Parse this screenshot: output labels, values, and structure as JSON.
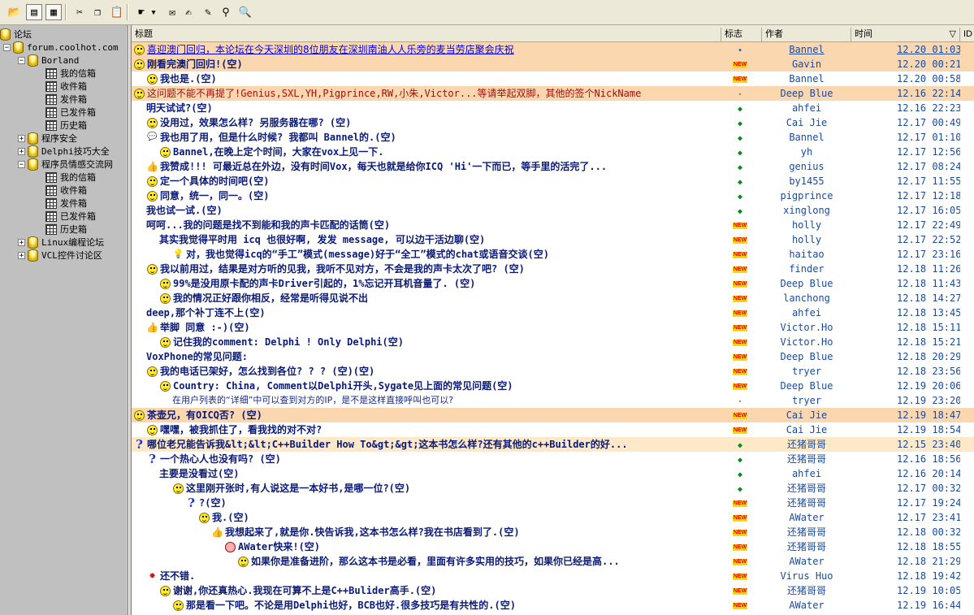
{
  "toolbar": {
    "buttons": [
      {
        "name": "open-folder-icon",
        "glyph": "📂",
        "pressed": false
      },
      {
        "name": "tree-view-icon",
        "glyph": "▤",
        "pressed": true
      },
      {
        "name": "list-view-icon",
        "glyph": "▦",
        "pressed": true
      },
      {
        "name": "cut-icon",
        "glyph": "✂",
        "pressed": false
      },
      {
        "name": "copy-icon",
        "glyph": "❐",
        "pressed": false
      },
      {
        "name": "paste-icon",
        "glyph": "📋",
        "pressed": false
      },
      {
        "name": "hand-pointer-icon",
        "glyph": "☛",
        "pressed": false
      },
      {
        "name": "dropdown-arrow-icon",
        "glyph": "▾",
        "pressed": false
      },
      {
        "name": "send-receive-icon",
        "glyph": "✉",
        "pressed": false
      },
      {
        "name": "compose-icon",
        "glyph": "✍",
        "pressed": false
      },
      {
        "name": "edit-icon",
        "glyph": "✎",
        "pressed": false
      },
      {
        "name": "binoculars-icon",
        "glyph": "⚲",
        "pressed": false
      },
      {
        "name": "magnifier-icon",
        "glyph": "🔍",
        "pressed": false
      }
    ]
  },
  "tree": {
    "nodes": [
      {
        "label": "论坛",
        "icon": "cyl",
        "level": 0,
        "box": ""
      },
      {
        "label": "forum.coolhot.com",
        "icon": "cyl",
        "level": 1,
        "box": "-"
      },
      {
        "label": "Borland",
        "icon": "cyl",
        "level": 2,
        "box": "-"
      },
      {
        "label": "我的信箱",
        "icon": "grid",
        "level": 3,
        "box": ""
      },
      {
        "label": "收件箱",
        "icon": "grid",
        "level": 3,
        "box": ""
      },
      {
        "label": "发件箱",
        "icon": "grid",
        "level": 3,
        "box": ""
      },
      {
        "label": "已发件箱",
        "icon": "grid",
        "level": 3,
        "box": ""
      },
      {
        "label": "历史箱",
        "icon": "grid",
        "level": 3,
        "box": ""
      },
      {
        "label": "程序安全",
        "icon": "cyl",
        "level": 2,
        "box": "+"
      },
      {
        "label": "Delphi技巧大全",
        "icon": "cyl",
        "level": 2,
        "box": "+"
      },
      {
        "label": "程序员情感交流网",
        "icon": "cyl",
        "level": 2,
        "box": "-"
      },
      {
        "label": "我的信箱",
        "icon": "grid",
        "level": 3,
        "box": ""
      },
      {
        "label": "收件箱",
        "icon": "grid",
        "level": 3,
        "box": ""
      },
      {
        "label": "发件箱",
        "icon": "grid",
        "level": 3,
        "box": ""
      },
      {
        "label": "已发件箱",
        "icon": "grid",
        "level": 3,
        "box": ""
      },
      {
        "label": "历史箱",
        "icon": "grid",
        "level": 3,
        "box": ""
      },
      {
        "label": "Linux编程论坛",
        "icon": "cyl",
        "level": 2,
        "box": "+"
      },
      {
        "label": "VCL控件讨论区",
        "icon": "cyl",
        "level": 2,
        "box": "+"
      }
    ]
  },
  "columns": {
    "title": "标题",
    "flag": "标志",
    "author": "作者",
    "time": "时间",
    "id": "ID"
  },
  "sort_icon": "▽",
  "posts": [
    {
      "indent": 0,
      "icon": "smiley",
      "style": "link",
      "bg": "hl",
      "flag": "bdot",
      "title": "喜迎澳门回归，本论坛在今天深圳的8位朋友在深圳南油人人乐旁的麦当劳店聚会庆祝",
      "author": "Bannel",
      "author_ul": true,
      "time": "12.20 01:03",
      "time_ul": true
    },
    {
      "indent": 0,
      "icon": "smiley",
      "style": "bold",
      "bg": "hl",
      "flag": "new",
      "title": "刚看完澳门回归!(空)",
      "author": "Gavin",
      "time": "12.20 00:21"
    },
    {
      "indent": 1,
      "icon": "smiley",
      "style": "bold",
      "bg": "",
      "flag": "new",
      "title": "我也是.(空)",
      "author": "Bannel",
      "time": "12.20 00:58"
    },
    {
      "indent": 0,
      "icon": "smiley",
      "style": "red",
      "bg": "hl",
      "flag": "gdot",
      "title": "这问题不能不再提了!Genius,SXL,YH,Pigprince,RW,小朱,Victor...等请举起双脚，其他的签个NickName",
      "author": "Deep Blue",
      "time": "12.16 22:14"
    },
    {
      "indent": 1,
      "icon": "",
      "style": "bold",
      "bg": "",
      "flag": "dot",
      "title": "明天试试?(空)",
      "author": "ahfei",
      "time": "12.16 22:23"
    },
    {
      "indent": 1,
      "icon": "smiley",
      "style": "bold",
      "bg": "",
      "flag": "dot",
      "title": "没用过，效果怎么样? 另服务器在哪? (空)",
      "author": "Cai Jie",
      "time": "12.17 00:49"
    },
    {
      "indent": 1,
      "icon": "bubble",
      "style": "bold",
      "bg": "",
      "flag": "dot",
      "title": "我也用了用，但是什么时候? 我都叫 Bannel的.(空)",
      "author": "Bannel",
      "time": "12.17 01:10"
    },
    {
      "indent": 2,
      "icon": "smiley",
      "style": "bold",
      "bg": "",
      "flag": "dot",
      "title": "Bannel,在晚上定个时间，大家在vox上见一下.",
      "author": "yh",
      "time": "12.17 12:56"
    },
    {
      "indent": 1,
      "icon": "thumb",
      "style": "bold",
      "bg": "",
      "flag": "dot",
      "title": "我赞成!!! 可最近总在外边，没有时间Vox，每天也就是给你ICQ 'Hi'一下而已，等手里的活完了...",
      "author": "genius",
      "time": "12.17 08:24"
    },
    {
      "indent": 1,
      "icon": "smiley",
      "style": "bold",
      "bg": "",
      "flag": "dot",
      "title": "定一个具体的时间吧(空)",
      "author": "by1455",
      "time": "12.17 11:55"
    },
    {
      "indent": 1,
      "icon": "smiley",
      "style": "bold",
      "bg": "",
      "flag": "dot",
      "title": "同意，统一，同一。(空)",
      "author": "pigprince",
      "time": "12.17 12:18"
    },
    {
      "indent": 1,
      "icon": "",
      "style": "bold",
      "bg": "",
      "flag": "dot",
      "title": "我也试一试.(空)",
      "author": "xinglong",
      "time": "12.17 16:05"
    },
    {
      "indent": 1,
      "icon": "",
      "style": "bold",
      "bg": "",
      "flag": "new",
      "title": "呵呵...我的问题是找不到能和我的声卡匹配的话筒(空)",
      "author": "holly",
      "time": "12.17 22:49"
    },
    {
      "indent": 2,
      "icon": "",
      "style": "bold",
      "bg": "",
      "flag": "new",
      "title": "其实我觉得平时用 icq 也很好啊, 发发 message, 可以边干活边聊(空)",
      "author": "holly",
      "time": "12.17 22:52"
    },
    {
      "indent": 3,
      "icon": "bulb",
      "style": "bold",
      "bg": "",
      "flag": "new",
      "title": "对，我也觉得icq的“手工”模式(message)好于“全工”模式的chat或语音交谈(空)",
      "author": "haitao",
      "time": "12.17 23:16"
    },
    {
      "indent": 1,
      "icon": "smiley",
      "style": "bold",
      "bg": "",
      "flag": "new",
      "title": "我以前用过，结果是对方听的见我，我听不见对方，不会是我的声卡太次了吧? (空)",
      "author": "finder",
      "time": "12.18 11:26"
    },
    {
      "indent": 2,
      "icon": "smiley",
      "style": "bold",
      "bg": "",
      "flag": "new",
      "title": "99%是没用原卡配的声卡Driver引起的，1%忘记开耳机音量了. (空)",
      "author": "Deep Blue",
      "time": "12.18 11:43"
    },
    {
      "indent": 2,
      "icon": "smiley",
      "style": "bold",
      "bg": "",
      "flag": "new",
      "title": "我的情况正好跟你相反，经常是听得见说不出",
      "author": "lanchong",
      "time": "12.18 14:27"
    },
    {
      "indent": 1,
      "icon": "",
      "style": "bold",
      "bg": "",
      "flag": "new",
      "title": "deep,那个补丁连不上(空)",
      "author": "ahfei",
      "time": "12.18 13:45"
    },
    {
      "indent": 1,
      "icon": "thumb",
      "style": "bold",
      "bg": "",
      "flag": "new",
      "title": "举脚 同意 :-)(空)",
      "author": "Victor.Ho",
      "time": "12.18 15:11"
    },
    {
      "indent": 2,
      "icon": "smiley",
      "style": "bold",
      "bg": "",
      "flag": "new",
      "title": "记住我的comment: Delphi ! Only Delphi(空)",
      "author": "Victor.Ho",
      "time": "12.18 15:21"
    },
    {
      "indent": 1,
      "icon": "",
      "style": "bold",
      "bg": "",
      "flag": "new",
      "title": "VoxPhone的常见问题:",
      "author": "Deep Blue",
      "time": "12.18 20:29"
    },
    {
      "indent": 1,
      "icon": "smiley",
      "style": "bold",
      "bg": "",
      "flag": "new",
      "title": "我的电话已架好，怎么找到各位? ? ? (空)(空)",
      "author": "tryer",
      "time": "12.18 23:56"
    },
    {
      "indent": 2,
      "icon": "smiley",
      "style": "bold",
      "bg": "",
      "flag": "new",
      "title": "Country: China, Comment以Delphi开头,Sygate见上面的常见问题(空)",
      "author": "Deep Blue",
      "time": "12.19 20:06"
    },
    {
      "indent": 3,
      "icon": "",
      "style": "plain",
      "bg": "",
      "flag": "gray",
      "title": "在用户列表的“详细”中可以查到对方的IP，是不是这样直接呼叫也可以?",
      "author": "tryer",
      "time": "12.19 23:20"
    },
    {
      "indent": 0,
      "icon": "smiley",
      "style": "bold",
      "bg": "hl",
      "flag": "new",
      "title": "茶壶兄，有OICQ否? (空)",
      "author": "Cai Jie",
      "time": "12.19 18:47"
    },
    {
      "indent": 1,
      "icon": "smiley",
      "style": "bold",
      "bg": "",
      "flag": "new",
      "title": "嘿嘿，被我抓住了，看我找的对不对?",
      "author": "Cai Jie",
      "time": "12.19 18:54"
    },
    {
      "indent": 0,
      "icon": "q",
      "style": "bold",
      "bg": "hl2",
      "flag": "dot",
      "title": "哪位老兄能告诉我&lt;&lt;C++Builder How To&gt;&gt;这本书怎么样?还有其他的c++Builder的好...",
      "author": "还猪哥哥",
      "time": "12.15 23:40"
    },
    {
      "indent": 1,
      "icon": "q",
      "style": "bold",
      "bg": "",
      "flag": "dot",
      "title": "一个热心人也没有吗? (空)",
      "author": "还猪哥哥",
      "time": "12.16 18:56"
    },
    {
      "indent": 2,
      "icon": "",
      "style": "bold",
      "bg": "",
      "flag": "dot",
      "title": "主要是没看过(空)",
      "author": "ahfei",
      "time": "12.16 20:14"
    },
    {
      "indent": 3,
      "icon": "smiley",
      "style": "bold",
      "bg": "",
      "flag": "dot",
      "title": "这里刚开张时,有人说这是一本好书,是哪一位?(空)",
      "author": "还猪哥哥",
      "time": "12.17 00:32"
    },
    {
      "indent": 4,
      "icon": "q",
      "style": "bold",
      "bg": "",
      "flag": "new",
      "title": "?(空)",
      "author": "还猪哥哥",
      "time": "12.17 19:24"
    },
    {
      "indent": 5,
      "icon": "smiley",
      "style": "bold",
      "bg": "",
      "flag": "new",
      "title": "我.(空)",
      "author": "AWater",
      "time": "12.17 23:41"
    },
    {
      "indent": 6,
      "icon": "thumb",
      "style": "bold",
      "bg": "",
      "flag": "new",
      "title": "我想起来了,就是你.快告诉我,这本书怎么样?我在书店看到了.(空)",
      "author": "还猪哥哥",
      "time": "12.18 00:32"
    },
    {
      "indent": 7,
      "icon": "sad",
      "style": "bold",
      "bg": "",
      "flag": "new",
      "title": "AWater快来!(空)",
      "author": "还猪哥哥",
      "time": "12.18 18:55"
    },
    {
      "indent": 8,
      "icon": "smiley",
      "style": "bold",
      "bg": "",
      "flag": "new",
      "title": "如果你是准备进阶，那么这本书是必看，里面有许多实用的技巧，如果你已经是高...",
      "author": "AWater",
      "time": "12.18 21:29"
    },
    {
      "indent": 1,
      "icon": "spark",
      "style": "bold",
      "bg": "",
      "flag": "new",
      "title": "还不错.",
      "author": "Virus Huo",
      "time": "12.18 19:42"
    },
    {
      "indent": 2,
      "icon": "smiley",
      "style": "bold",
      "bg": "",
      "flag": "new",
      "title": "谢谢,你还真热心.我现在可算不上是C++Bulider高手.(空)",
      "author": "还猪哥哥",
      "time": "12.19 10:05"
    },
    {
      "indent": 3,
      "icon": "smiley",
      "style": "bold",
      "bg": "",
      "flag": "new",
      "title": "那是看一下吧。不论是用Delphi也好，BCB也好.很多技巧是有共性的.(空)",
      "author": "AWater",
      "time": "12.19 16:44"
    }
  ],
  "new_badge": "NEW"
}
